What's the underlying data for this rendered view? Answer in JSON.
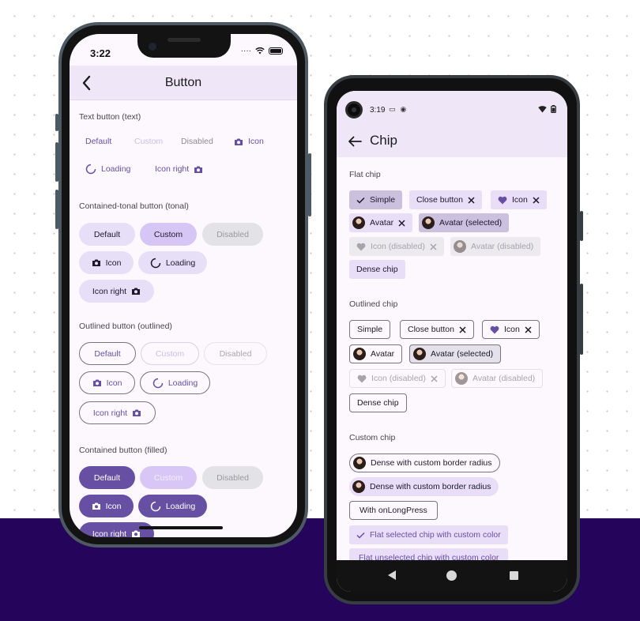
{
  "button_demo": {
    "status": {
      "time": "3:22"
    },
    "title": "Button",
    "text_section": {
      "label": "Text button (text)",
      "default": "Default",
      "custom": "Custom",
      "disabled": "Disabled",
      "icon": "Icon",
      "loading": "Loading",
      "icon_right": "Icon right"
    },
    "tonal_section": {
      "label": "Contained-tonal button (tonal)",
      "default": "Default",
      "custom": "Custom",
      "disabled": "Disabled",
      "icon": "Icon",
      "loading": "Loading",
      "icon_right": "Icon right"
    },
    "outlined_section": {
      "label": "Outlined button (outlined)",
      "default": "Default",
      "custom": "Custom",
      "disabled": "Disabled",
      "icon": "Icon",
      "loading": "Loading",
      "icon_right": "Icon right"
    },
    "filled_section": {
      "label": "Contained button (filled)",
      "default": "Default",
      "custom": "Custom",
      "disabled": "Disabled",
      "icon": "Icon",
      "loading": "Loading",
      "icon_right": "Icon right"
    }
  },
  "chip_demo": {
    "status": {
      "time": "3:19"
    },
    "title": "Chip",
    "flat_section": {
      "label": "Flat chip",
      "simple": "Simple",
      "close_button": "Close button",
      "icon": "Icon",
      "avatar": "Avatar",
      "avatar_selected": "Avatar (selected)",
      "icon_disabled": "Icon (disabled)",
      "avatar_disabled": "Avatar (disabled)",
      "dense": "Dense chip"
    },
    "outlined_section": {
      "label": "Outlined chip",
      "simple": "Simple",
      "close_button": "Close button",
      "icon": "Icon",
      "avatar": "Avatar",
      "avatar_selected": "Avatar (selected)",
      "icon_disabled": "Icon (disabled)",
      "avatar_disabled": "Avatar (disabled)",
      "dense": "Dense chip"
    },
    "custom_section": {
      "label": "Custom chip",
      "dense_radius_outlined": "Dense with custom border radius",
      "dense_radius_flat": "Dense with custom border radius",
      "long_press": "With onLongPress",
      "flat_selected_color": "Flat selected chip with custom color",
      "flat_unselected_color": "Flat unselected chip with custom color"
    }
  },
  "colors": {
    "primary": "#6750a4",
    "secondary_container": "#e8def8",
    "surface": "#fdf8fd",
    "background_band": "#25055c"
  },
  "icons": [
    "chevron-left-icon",
    "camera-icon",
    "loading-spinner-icon",
    "checkmark-icon",
    "close-icon",
    "heart-icon",
    "avatar-icon",
    "arrow-left-icon",
    "wifi-icon",
    "battery-icon"
  ]
}
